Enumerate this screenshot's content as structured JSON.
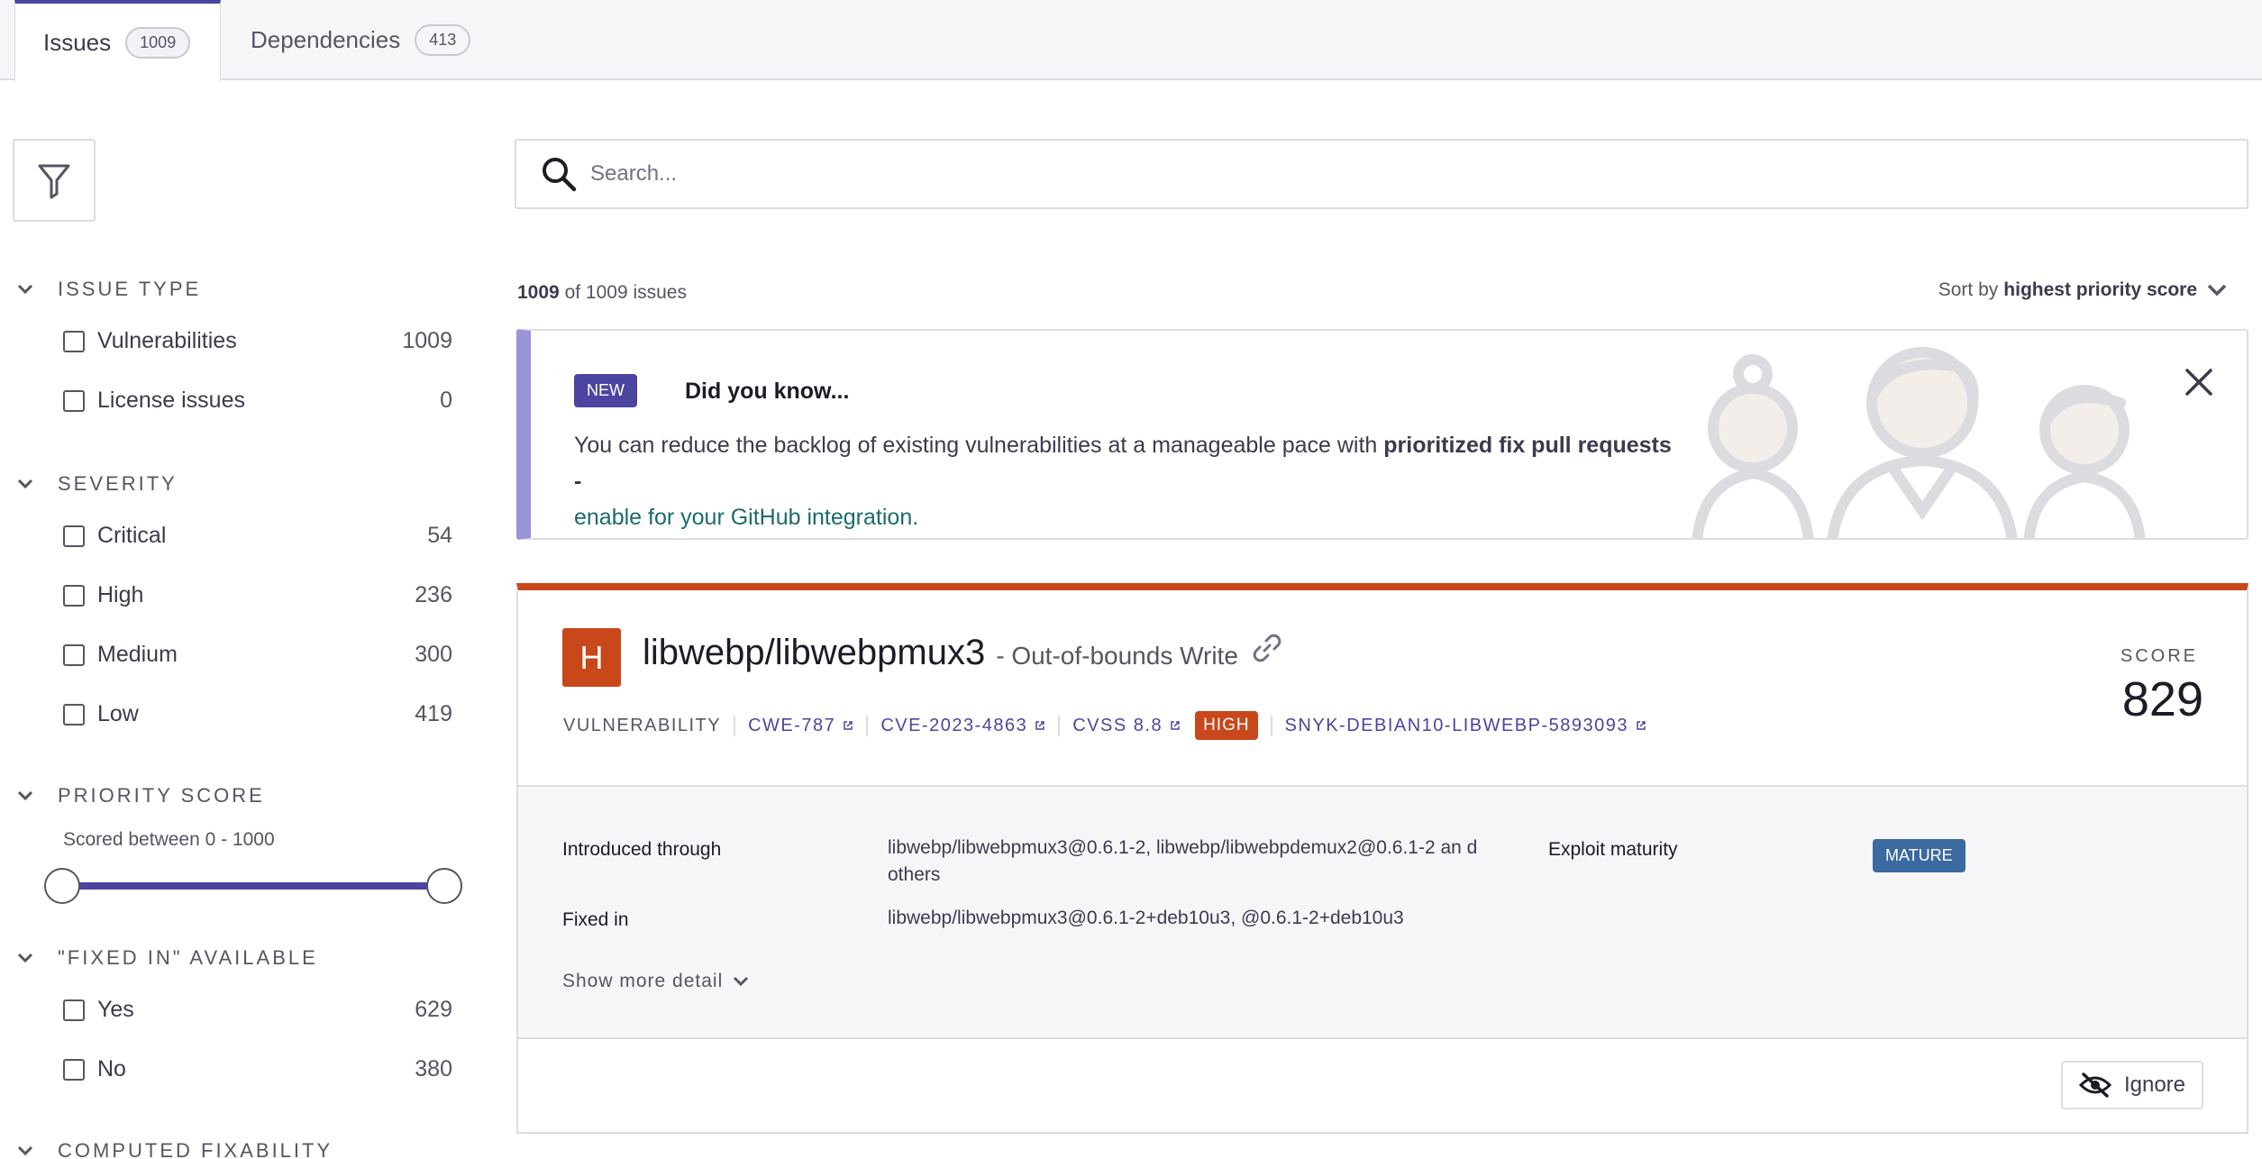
{
  "tabs": [
    {
      "label": "Issues",
      "count": "1009"
    },
    {
      "label": "Dependencies",
      "count": "413"
    }
  ],
  "sidebar": {
    "sections": [
      {
        "title": "ISSUE TYPE",
        "items": [
          {
            "label": "Vulnerabilities",
            "count": "1009"
          },
          {
            "label": "License issues",
            "count": "0"
          }
        ]
      },
      {
        "title": "SEVERITY",
        "items": [
          {
            "label": "Critical",
            "count": "54"
          },
          {
            "label": "High",
            "count": "236"
          },
          {
            "label": "Medium",
            "count": "300"
          },
          {
            "label": "Low",
            "count": "419"
          }
        ]
      },
      {
        "title": "PRIORITY SCORE",
        "range_text": "Scored between 0 - 1000",
        "range": [
          0,
          1000
        ]
      },
      {
        "title": "\"FIXED IN\" AVAILABLE",
        "items": [
          {
            "label": "Yes",
            "count": "629"
          },
          {
            "label": "No",
            "count": "380"
          }
        ]
      },
      {
        "title": "COMPUTED FIXABILITY"
      }
    ]
  },
  "search": {
    "placeholder": "Search..."
  },
  "results": {
    "shown": "1009",
    "of_text": "of 1009 issues"
  },
  "sort": {
    "prefix": "Sort by",
    "value": "highest priority score"
  },
  "banner": {
    "badge": "NEW",
    "title": "Did you know...",
    "text": "You can reduce the backlog of existing vulnerabilities at a manageable pace with ",
    "bold": "prioritized fix pull requests -",
    "link": "enable for your GitHub integration."
  },
  "issue": {
    "severity_letter": "H",
    "package": "libwebp/libwebpmux3",
    "title_suffix": "- Out-of-bounds Write",
    "type": "VULNERABILITY",
    "cwe": "CWE-787",
    "cve": "CVE-2023-4863",
    "cvss": "CVSS 8.8",
    "severity": "HIGH",
    "snyk_id": "SNYK-DEBIAN10-LIBWEBP-5893093",
    "score_label": "SCORE",
    "score": "829",
    "introduced_label": "Introduced through",
    "introduced_value": "libwebp/libwebpmux3@0.6.1-2, libwebp/libwebpdemux2@0.6.1-2 an d others",
    "fixed_label": "Fixed in",
    "fixed_value": "libwebp/libwebpmux3@0.6.1-2+deb10u3, @0.6.1-2+deb10u3",
    "exploit_label": "Exploit maturity",
    "exploit_value": "MATURE",
    "show_more": "Show more detail",
    "ignore": "Ignore"
  },
  "colors": {
    "accent": "#4b45a1",
    "high": "#c8471b",
    "mature": "#3b6aa0",
    "banner_bar": "#9894d6"
  }
}
